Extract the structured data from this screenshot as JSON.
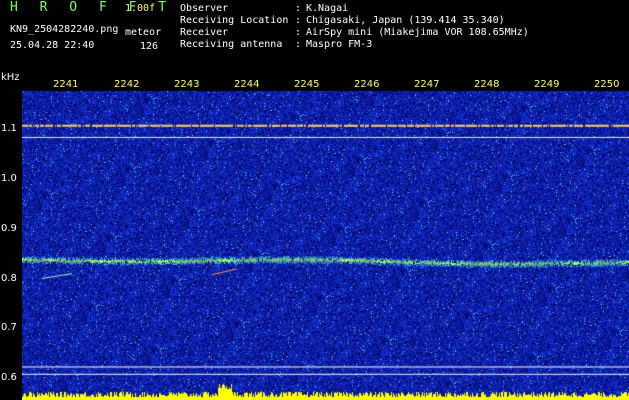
{
  "header": {
    "app_title": "H R O F F T",
    "version": "1.00f",
    "filename": "KN9_2504282240.png",
    "datetime": "25.04.28 22:40",
    "meteor_label": "meteor",
    "meteor_count": "126"
  },
  "station": {
    "rows": [
      {
        "label": "Observer",
        "value": "K.Nagai"
      },
      {
        "label": "Receiving Location",
        "value": "Chigasaki, Japan (139.414 35.340)"
      },
      {
        "label": "Receiver",
        "value": "AirSpy mini (Miakejima VOR 108.65MHz)"
      },
      {
        "label": "Receiving antenna",
        "value": "Maspro FM-3"
      }
    ],
    "separator": ":"
  },
  "spectrogram": {
    "freq_unit": "kHz",
    "time_ticks": [
      "2241",
      "2242",
      "2243",
      "2244",
      "2245",
      "2246",
      "2247",
      "2248",
      "2249",
      "2250"
    ],
    "freq_ticks": [
      "1.1",
      "1.0",
      "0.9",
      "0.8",
      "0.7",
      "0.6"
    ],
    "freq_range_khz": [
      0.58,
      1.18
    ],
    "carrier_khz": 0.84,
    "upper_lines_khz": [
      1.115,
      1.09
    ],
    "lower_lines_khz": [
      0.62,
      0.605
    ],
    "colors": {
      "background": "#000000",
      "noise_base": "#0a1a8c",
      "carrier": "#7dff5a",
      "line": "#ffffff",
      "activity_bar": "#ffff00"
    }
  }
}
